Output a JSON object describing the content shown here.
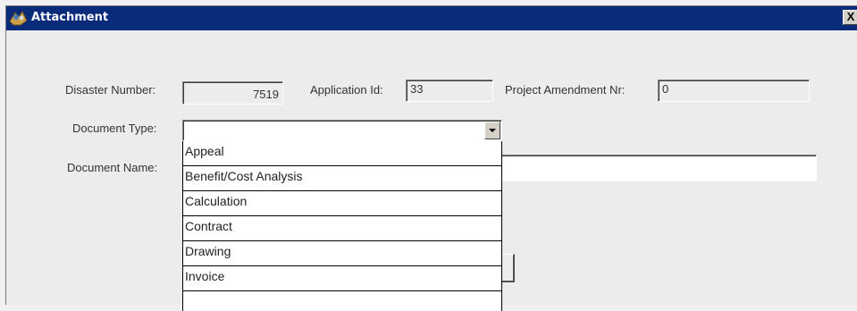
{
  "window": {
    "title": "Attachment",
    "close_label": "X"
  },
  "fields": {
    "disaster_number_label": "Disaster Number:",
    "disaster_number_value": "7519",
    "application_id_label": "Application Id:",
    "application_id_value": "33",
    "project_amendment_label": "Project Amendment Nr:",
    "project_amendment_value": "0",
    "document_type_label": "Document Type:",
    "document_type_value": "",
    "document_name_label": "Document Name:",
    "document_name_value": ""
  },
  "dropdown": {
    "options": [
      "Appeal",
      "Benefit/Cost Analysis",
      "Calculation",
      "Contract",
      "Drawing",
      "Invoice"
    ]
  },
  "colors": {
    "titlebar": "#0a2a7a",
    "background": "#ececec"
  }
}
